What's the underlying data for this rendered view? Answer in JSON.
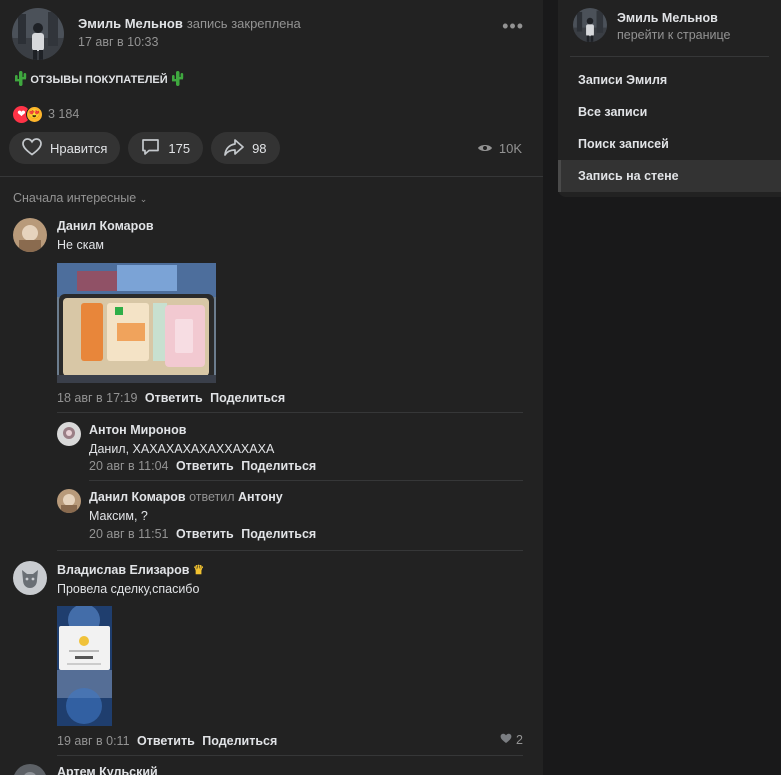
{
  "post": {
    "author": "Эмиль Мельнов",
    "pinned_note": "запись закреплена",
    "date": "17 авг в 10:33",
    "text": "отзывы покупателей",
    "reactions_count": "3 184",
    "like_label": "Нравится",
    "comments_count": "175",
    "shares_count": "98",
    "views": "10K"
  },
  "sort_label": "Сначала интересные",
  "comments": {
    "c1": {
      "author": "Данил Комаров",
      "text": "Не скам",
      "date": "18 авг в 17:19",
      "reply": "Ответить",
      "share": "Поделиться"
    },
    "r1": {
      "author": "Антон Миронов",
      "text": "Данил, ХАХАХАХАХАХХАХАХА",
      "date": "20 авг в 11:04",
      "reply": "Ответить",
      "share": "Поделиться"
    },
    "r2": {
      "author": "Данил Комаров",
      "replied": "ответил",
      "target": "Антону",
      "text": "Максим, ?",
      "date": "20 авг в 11:51",
      "reply": "Ответить",
      "share": "Поделиться"
    },
    "c2": {
      "author": "Владислав Елизаров",
      "text": "Провела сделку,спасибо",
      "date": "19 авг в 0:11",
      "reply": "Ответить",
      "share": "Поделиться",
      "likes": "2"
    },
    "c3": {
      "author": "Артем Кульский"
    }
  },
  "sidebar": {
    "name": "Эмиль Мельнов",
    "subtitle": "перейти к странице",
    "items": [
      {
        "label": "Записи Эмиля"
      },
      {
        "label": "Все записи"
      },
      {
        "label": "Поиск записей"
      },
      {
        "label": "Запись на стене",
        "active": true
      }
    ]
  },
  "colors": {
    "background": "#19191a",
    "panel": "#222222",
    "pill": "#333333",
    "muted": "#939393",
    "text": "#e1e3e6",
    "heart": "#ff3347"
  }
}
